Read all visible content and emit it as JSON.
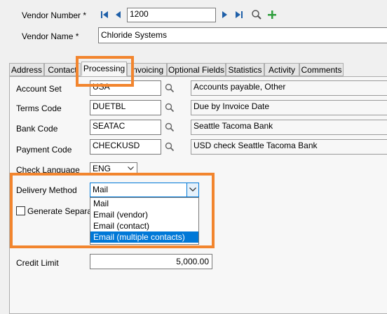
{
  "header": {
    "vendor_number_label": "Vendor Number *",
    "vendor_number_value": "1200",
    "vendor_name_label": "Vendor Name *",
    "vendor_name_value": "Chloride Systems"
  },
  "tabs": [
    {
      "label": "Address"
    },
    {
      "label": "Contact"
    },
    {
      "label": "Processing"
    },
    {
      "label": "Invoicing"
    },
    {
      "label": "Optional Fields"
    },
    {
      "label": "Statistics"
    },
    {
      "label": "Activity"
    },
    {
      "label": "Comments"
    }
  ],
  "fields": {
    "account_set_label": "Account Set",
    "account_set_value": "USA",
    "account_set_desc": "Accounts payable, Other",
    "terms_code_label": "Terms Code",
    "terms_code_value": "DUETBL",
    "terms_code_desc": "Due by Invoice Date",
    "bank_code_label": "Bank Code",
    "bank_code_value": "SEATAC",
    "bank_code_desc": "Seattle Tacoma Bank",
    "payment_code_label": "Payment Code",
    "payment_code_value": "CHECKUSD",
    "payment_code_desc": "USD check Seattle Tacoma Bank",
    "check_language_label": "Check Language",
    "check_language_value": "ENG",
    "delivery_method_label": "Delivery Method",
    "delivery_method_value": "Mail",
    "generate_separate_label": "Generate Separate",
    "credit_limit_label": "Credit Limit",
    "credit_limit_value": "5,000.00"
  },
  "delivery_options": [
    "Mail",
    "Email (vendor)",
    "Email (contact)",
    "Email (multiple contacts)"
  ],
  "colors": {
    "highlight": "#f2852e",
    "selection": "#0078d7",
    "nav_icon": "#1e5fa8",
    "add_icon": "#2e9e3c"
  }
}
